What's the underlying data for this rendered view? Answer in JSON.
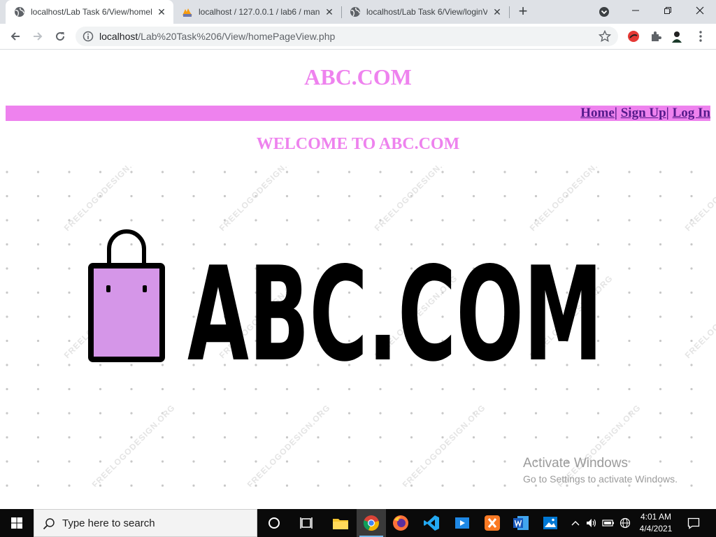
{
  "browser": {
    "tabs": [
      {
        "title": "localhost/Lab Task 6/View/homeP",
        "active": true
      },
      {
        "title": "localhost / 127.0.0.1 / lab6 / man",
        "active": false
      },
      {
        "title": "localhost/Lab Task 6/View/loginV",
        "active": false
      }
    ],
    "new_tab_label": "+",
    "address": {
      "host": "localhost",
      "path": "/Lab%20Task%206/View/homePageView.php"
    }
  },
  "page": {
    "site_title": "ABC.COM",
    "nav": {
      "home": "Home",
      "sep1": "| ",
      "signup": "Sign Up",
      "sep2": "| ",
      "login": "Log In"
    },
    "welcome": "WELCOME TO ABC.COM",
    "banner": {
      "logo_text": "ABC.COM",
      "watermark": "FREELOGODESIGN.ORG"
    }
  },
  "windows_notice": {
    "title": "Activate Windows",
    "subtitle": "Go to Settings to activate Windows."
  },
  "taskbar": {
    "search_placeholder": "Type here to search",
    "time": "4:01 AM",
    "date": "4/4/2021"
  },
  "colors": {
    "accent": "#ee82ee",
    "link": "#551a8b",
    "bag_fill": "#d596e8"
  }
}
